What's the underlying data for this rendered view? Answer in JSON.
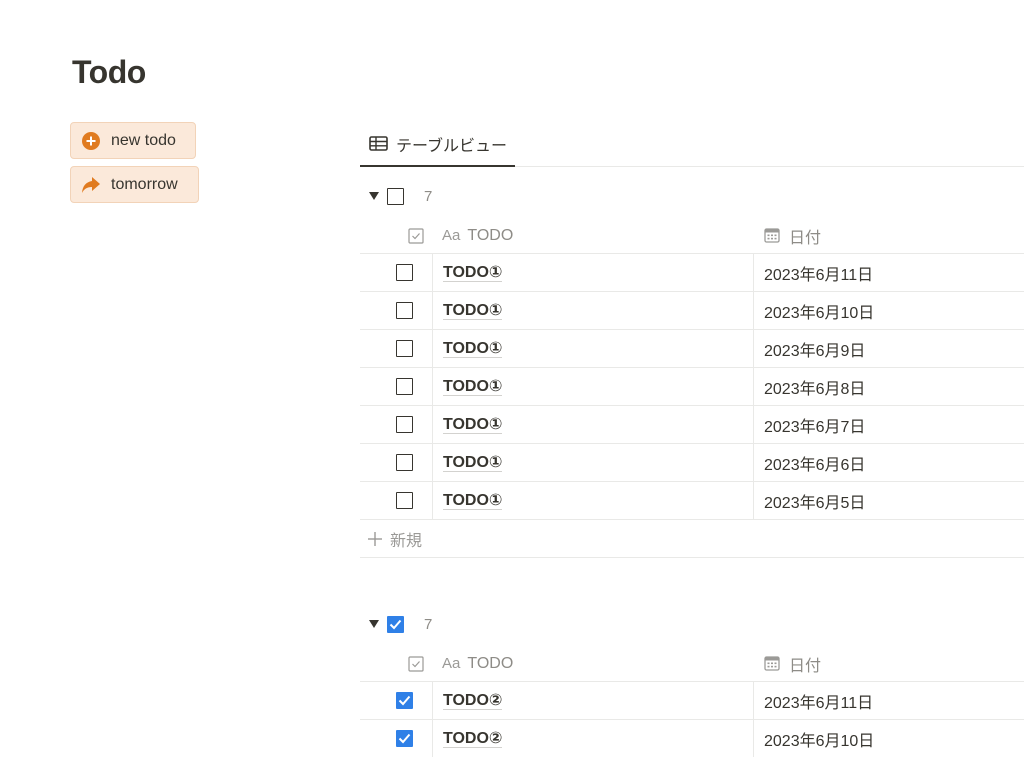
{
  "page": {
    "title": "Todo"
  },
  "buttons": {
    "new_todo": "new todo",
    "tomorrow": "tomorrow"
  },
  "views": {
    "table_view": "テーブルビュー"
  },
  "columns": {
    "todo": "TODO",
    "todo_type_icon_text": "Aa",
    "date": "日付"
  },
  "groups": [
    {
      "checked": false,
      "count": "7",
      "rows": [
        {
          "todo": "TODO①",
          "date": "2023年6月11日",
          "done": false
        },
        {
          "todo": "TODO①",
          "date": "2023年6月10日",
          "done": false
        },
        {
          "todo": "TODO①",
          "date": "2023年6月9日",
          "done": false
        },
        {
          "todo": "TODO①",
          "date": "2023年6月8日",
          "done": false
        },
        {
          "todo": "TODO①",
          "date": "2023年6月7日",
          "done": false
        },
        {
          "todo": "TODO①",
          "date": "2023年6月6日",
          "done": false
        },
        {
          "todo": "TODO①",
          "date": "2023年6月5日",
          "done": false
        }
      ],
      "new_label": "新規"
    },
    {
      "checked": true,
      "count": "7",
      "rows": [
        {
          "todo": "TODO②",
          "date": "2023年6月11日",
          "done": true
        },
        {
          "todo": "TODO②",
          "date": "2023年6月10日",
          "done": true
        }
      ]
    }
  ],
  "colors": {
    "checkbox_checked": "#2f80e7",
    "button_bg": "#fbe9da",
    "button_icon": "#e07b20"
  },
  "icons": {
    "new_todo": "plus-circle-icon",
    "tomorrow": "forward-arrow-icon",
    "table_view": "table-icon",
    "toggle": "triangle-down-icon",
    "column_check": "checkbox-column-icon",
    "column_date": "calendar-icon",
    "new_row": "plus-icon"
  }
}
